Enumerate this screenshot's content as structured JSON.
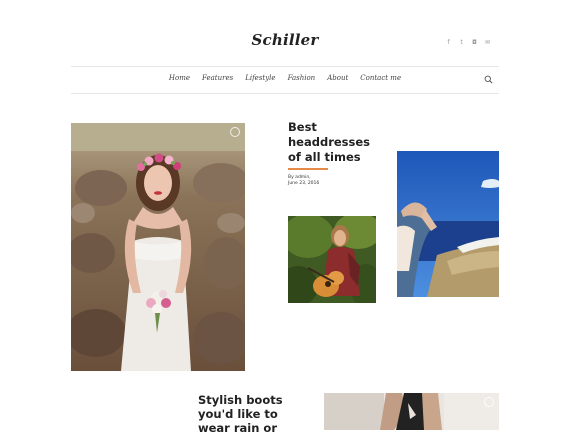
{
  "header": {
    "logo": "Schiller",
    "social_icons": [
      "facebook-icon",
      "twitter-icon",
      "instagram-icon",
      "email-icon"
    ],
    "social_glyphs": [
      "f",
      "t",
      "◘",
      "✉"
    ]
  },
  "nav": {
    "items": [
      "Home",
      "Features",
      "Lifestyle",
      "Fashion",
      "About",
      "Contact me"
    ]
  },
  "posts": [
    {
      "title": "Best headdresses of all times",
      "author": "By admin,",
      "date": "June 23, 2016",
      "accent": "#e68a4a"
    },
    {
      "title": "Stylish boots you'd like to wear rain or"
    }
  ]
}
